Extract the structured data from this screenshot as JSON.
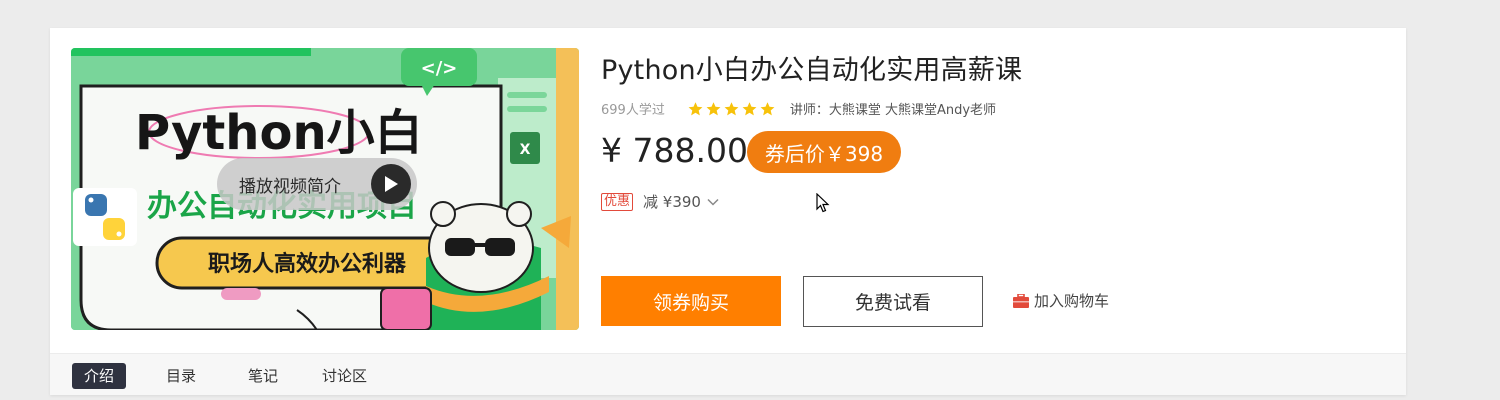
{
  "course": {
    "title": "Python小白办公自动化实用高薪课",
    "learners": "699人学过",
    "rating": 5,
    "lecturer": "讲师：大熊课堂 大熊课堂Andy老师",
    "price": "¥ 788.00",
    "coupon_price": "券后价￥398",
    "discount_tag": "优惠",
    "discount_amount": "减 ¥390",
    "thumbnail": {
      "headline": "Python小白",
      "subheadline": "办公自动化实用项目",
      "banner": "职场人高效办公利器",
      "code_tag": "</>",
      "play_label": "播放视频简介",
      "play_icon": "play-icon"
    }
  },
  "actions": {
    "buy_label": "领券购买",
    "trial_label": "免费试看",
    "cart_label": "加入购物车",
    "cart_icon": "cart-icon"
  },
  "tabs": [
    {
      "label": "介绍",
      "active": true
    },
    {
      "label": "目录",
      "active": false
    },
    {
      "label": "笔记",
      "active": false
    },
    {
      "label": "讨论区",
      "active": false
    }
  ],
  "colors": {
    "accent_orange": "#ff7f00",
    "badge_orange": "#f07d10",
    "star_yellow": "#f7c20b",
    "discount_red": "#e24a3b",
    "tab_active": "#2f3240"
  }
}
